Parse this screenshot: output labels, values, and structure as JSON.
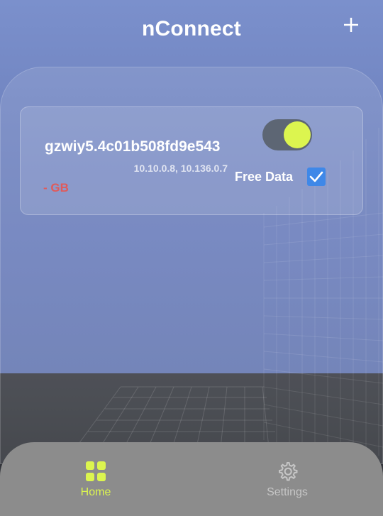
{
  "header": {
    "title": "nConnect",
    "add_icon": "plus-icon"
  },
  "connection": {
    "name": "gzwiy5.4c01b508fd9e543",
    "ips": "10.10.0.8, 10.136.0.7",
    "usage": "- GB",
    "toggle_on": true,
    "free_data_label": "Free Data",
    "free_data_checked": true
  },
  "bottom_nav": {
    "items": [
      {
        "label": "Home",
        "icon": "grid-icon",
        "active": true
      },
      {
        "label": "Settings",
        "icon": "gear-icon",
        "active": false
      }
    ]
  },
  "colors": {
    "accent": "#dcf54f",
    "checkbox": "#3f88e8",
    "usage_text": "#e05a5a",
    "nav_bar": "#8c8c8c"
  }
}
